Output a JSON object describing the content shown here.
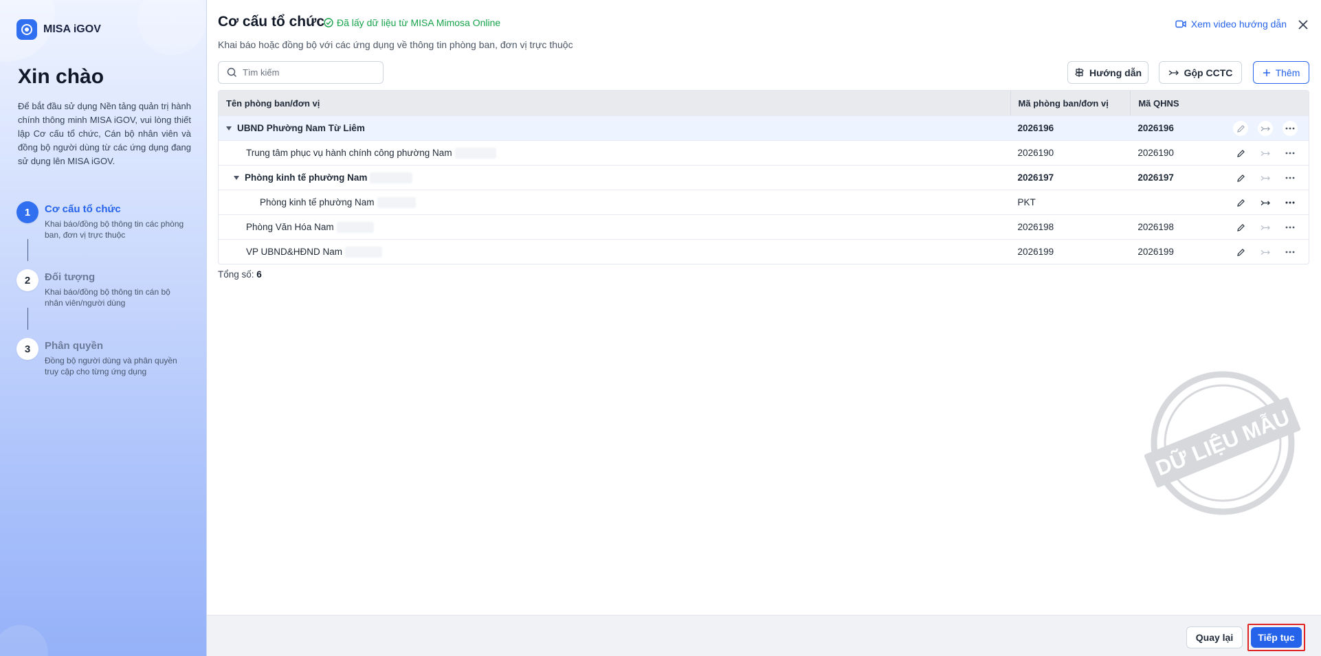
{
  "brand": {
    "name": "MISA iGOV",
    "color": "#2f6ff0"
  },
  "sidebar": {
    "greeting": "Xin chào",
    "intro": "Để bắt đầu sử dụng Nền tảng quản trị hành chính thông minh MISA iGOV, vui lòng thiết lập Cơ cấu tổ chức, Cán bộ nhân viên và đồng bộ người dùng từ các ứng dụng đang sử dụng lên MISA iGOV.",
    "steps": [
      {
        "num": "1",
        "title": "Cơ cấu tổ chức",
        "desc": "Khai báo/đồng bộ thông tin các phòng ban, đơn vị trực thuộc",
        "active": true
      },
      {
        "num": "2",
        "title": "Đối tượng",
        "desc": "Khai báo/đồng bộ thông tin cán bộ nhân viên/người dùng",
        "active": false
      },
      {
        "num": "3",
        "title": "Phân quyền",
        "desc": "Đồng bộ người dùng và phân quyền truy cập cho từng ứng dụng",
        "active": false
      }
    ]
  },
  "header": {
    "title": "Cơ cấu tổ chức",
    "sync_status": "Đã lấy dữ liệu từ MISA Mimosa Online",
    "subtitle": "Khai báo hoặc đồng bộ với các ứng dụng về thông tin phòng ban, đơn vị trực thuộc",
    "video_link": "Xem video hướng dẫn"
  },
  "toolbar": {
    "search_placeholder": "Tìm kiếm",
    "guide_label": "Hướng dẫn",
    "merge_label": "Gộp CCTC",
    "add_label": "Thêm"
  },
  "table": {
    "columns": [
      "Tên phòng ban/đơn vị",
      "Mã phòng ban/đơn vị",
      "Mã QHNS"
    ],
    "rows": [
      {
        "name": "UBND Phường Nam Từ Liêm",
        "code": "2026196",
        "qhns": "2026196"
      },
      {
        "name": "Trung tâm phục vụ hành chính công phường Nam",
        "code": "2026190",
        "qhns": "2026190"
      },
      {
        "name": "Phòng kinh tế phường Nam",
        "code": "2026197",
        "qhns": "2026197"
      },
      {
        "name": "Phòng kinh tế phường Nam",
        "code": "PKT",
        "qhns": ""
      },
      {
        "name": "Phòng Văn Hóa Nam",
        "code": "2026198",
        "qhns": "2026198"
      },
      {
        "name": "VP UBND&HĐND Nam",
        "code": "2026199",
        "qhns": "2026199"
      }
    ]
  },
  "total": {
    "label": "Tổng số:",
    "value": "6"
  },
  "stamp": {
    "text": "DỮ LIỆU MẪU"
  },
  "footer": {
    "back_label": "Quay lại",
    "next_label": "Tiếp tục"
  },
  "colors": {
    "accent": "#2563eb",
    "success": "#16a34a",
    "highlight_border": "#e02424"
  }
}
